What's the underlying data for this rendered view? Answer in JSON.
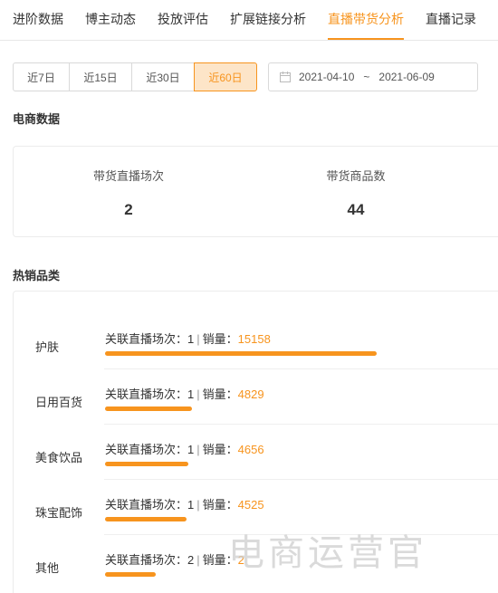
{
  "tabs": [
    {
      "label": "进阶数据",
      "active": false
    },
    {
      "label": "博主动态",
      "active": false
    },
    {
      "label": "投放评估",
      "active": false
    },
    {
      "label": "扩展链接分析",
      "active": false
    },
    {
      "label": "直播带货分析",
      "active": true
    },
    {
      "label": "直播记录",
      "active": false
    }
  ],
  "periods": [
    {
      "label": "近7日",
      "active": false
    },
    {
      "label": "近15日",
      "active": false
    },
    {
      "label": "近30日",
      "active": false
    },
    {
      "label": "近60日",
      "active": true
    }
  ],
  "date_range": {
    "start": "2021-04-10",
    "separator": "~",
    "end": "2021-06-09"
  },
  "ecommerce": {
    "title": "电商数据",
    "stats": [
      {
        "label": "带货直播场次",
        "value": "2"
      },
      {
        "label": "带货商品数",
        "value": "44"
      }
    ]
  },
  "hot_categories": {
    "title": "热销品类",
    "items": [
      {
        "name": "护肤",
        "prefix": "关联直播场次：",
        "sessions": "1",
        "sep": "|",
        "sales_label": "销量：",
        "sales": "15158",
        "share": 1.0
      },
      {
        "name": "日用百货",
        "prefix": "关联直播场次：",
        "sessions": "1",
        "sep": "|",
        "sales_label": "销量：",
        "sales": "4829",
        "share": 0.319
      },
      {
        "name": "美食饮品",
        "prefix": "关联直播场次：",
        "sessions": "1",
        "sep": "|",
        "sales_label": "销量：",
        "sales": "4656",
        "share": 0.307
      },
      {
        "name": "珠宝配饰",
        "prefix": "关联直播场次：",
        "sessions": "1",
        "sep": "|",
        "sales_label": "销量：",
        "sales": "4525",
        "share": 0.299
      },
      {
        "name": "其他",
        "prefix": "关联直播场次：",
        "sessions": "2",
        "sep": "|",
        "sales_label": "销量：",
        "sales": "2",
        "share": 0.187
      }
    ]
  },
  "watermark": "电商运营官",
  "colors": {
    "accent": "#f7941e",
    "accent_bg": "#fde5c8",
    "border": "#d9d9d9"
  }
}
